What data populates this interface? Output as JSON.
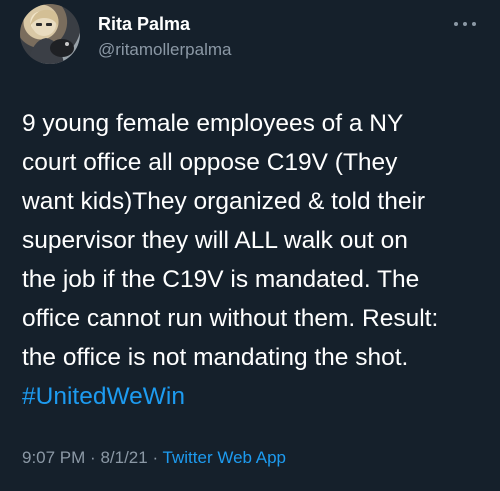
{
  "author": {
    "display_name": "Rita Palma",
    "handle": "@ritamollerpalma"
  },
  "tweet": {
    "lines": [
      "9 young female employees of a NY",
      "court office all oppose C19V (They",
      "want kids)They organized & told their",
      "supervisor they will ALL walk out on",
      "the job if the C19V is mandated. The",
      "office cannot run without them. Result:",
      "the office is not mandating the shot."
    ],
    "hashtag": "#UnitedWeWin"
  },
  "meta": {
    "time": "9:07 PM",
    "separator": "·",
    "date": "8/1/21",
    "source": "Twitter Web App"
  },
  "colors": {
    "background": "#15202b",
    "text": "#ffffff",
    "secondary": "#8b98a5",
    "link": "#1d9bf0"
  },
  "icons": {
    "more": "more-icon"
  }
}
